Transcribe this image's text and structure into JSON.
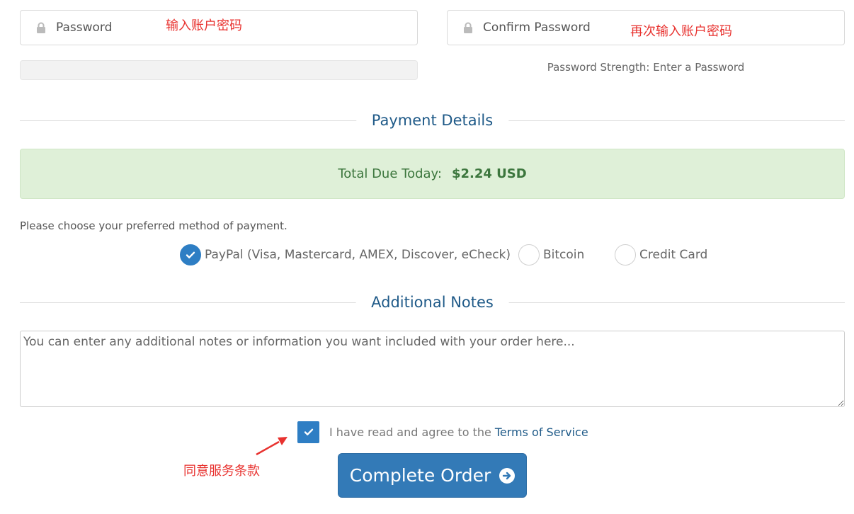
{
  "password": {
    "placeholder": "Password",
    "annotation": "输入账户密码"
  },
  "confirm_password": {
    "placeholder": "Confirm Password",
    "annotation": "再次输入账户密码"
  },
  "password_strength": {
    "text": "Password Strength: Enter a Password",
    "level": 0
  },
  "payment": {
    "heading": "Payment Details",
    "total_label": "Total Due Today:",
    "total_amount": "$2.24 USD",
    "choose_text": "Please choose your preferred method of payment.",
    "methods": [
      {
        "label": "PayPal (Visa, Mastercard, AMEX, Discover, eCheck)",
        "selected": true
      },
      {
        "label": "Bitcoin",
        "selected": false
      },
      {
        "label": "Credit Card",
        "selected": false
      }
    ]
  },
  "notes": {
    "heading": "Additional Notes",
    "placeholder": "You can enter any additional notes or information you want included with your order here..."
  },
  "terms": {
    "text": "I have read and agree to the",
    "link": "Terms of Service",
    "checked": true,
    "annotation": "同意服务条款"
  },
  "submit": {
    "label": "Complete Order"
  },
  "colors": {
    "accent": "#337ab7",
    "heading": "#1f5a88",
    "success_bg": "#dff0d8",
    "annotation_red": "#e8322f"
  },
  "icons": [
    "lock-icon",
    "check-icon",
    "arrow-circle-right-icon",
    "annotation-arrow-icon"
  ]
}
